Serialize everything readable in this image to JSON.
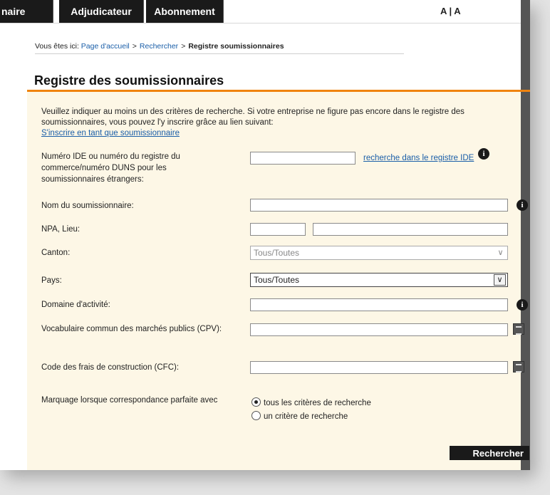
{
  "nav": {
    "tabs": [
      {
        "label": "naire"
      },
      {
        "label": "Adjudicateur"
      },
      {
        "label": "Abonnement"
      }
    ],
    "font_switch": "A | A"
  },
  "breadcrumb": {
    "prefix": "Vous êtes ici:",
    "items": [
      "Page d'accueil",
      "Rechercher",
      "Registre soumissionnaires"
    ],
    "separator": ">"
  },
  "title": "Registre des soumissionnaires",
  "intro": {
    "text": "Veuillez indiquer au moins un des critères de recherche. Si votre entreprise ne figure pas encore dans le registre des soumissionnaires, vous pouvez l'y inscrire grâce au lien suivant:",
    "link": "S'inscrire en tant que soumissionnaire"
  },
  "fields": {
    "ide": {
      "label": "Numéro IDE ou numéro du registre du commerce/numéro DUNS pour les soumissionnaires étrangers:",
      "value": "",
      "link": "recherche dans le registre IDE"
    },
    "name": {
      "label": "Nom du soumissionnaire:",
      "value": ""
    },
    "npa": {
      "label": "NPA, Lieu:",
      "npa_value": "",
      "lieu_value": ""
    },
    "canton": {
      "label": "Canton:",
      "selected": "Tous/Toutes"
    },
    "pays": {
      "label": "Pays:",
      "selected": "Tous/Toutes"
    },
    "domaine": {
      "label": "Domaine d'activité:",
      "value": ""
    },
    "cpv": {
      "label": "Vocabulaire commun des marchés publics (CPV):",
      "value": ""
    },
    "cfc": {
      "label": "Code des frais de construction (CFC):",
      "value": ""
    },
    "marquage": {
      "label": "Marquage lorsque correspondance parfaite avec",
      "options": [
        "tous les critères de recherche",
        "un critère de recherche"
      ],
      "selected_index": 0
    }
  },
  "search_button": "Rechercher",
  "colors": {
    "accent": "#f0830f",
    "nav_bg": "#1a1a1a",
    "form_bg": "#fdf7e6",
    "link": "#1a5ea8"
  }
}
